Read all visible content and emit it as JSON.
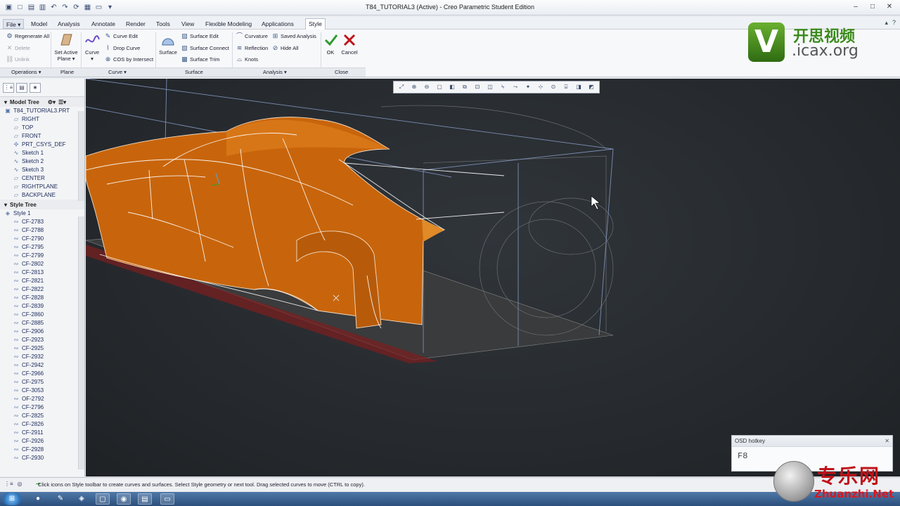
{
  "window": {
    "title": "T84_TUTORIAL3 (Active) - Creo Parametric Student Edition"
  },
  "menu": {
    "file": "File",
    "tabs": [
      "Model",
      "Analysis",
      "Annotate",
      "Render",
      "Tools",
      "View",
      "Flexible Modeling",
      "Applications",
      "Style"
    ],
    "active_tab": "Style"
  },
  "ribbon": {
    "operations": {
      "regenerate": "Regenerate All",
      "delete": "Delete",
      "unlink": "Unlink",
      "label": "Operations"
    },
    "plane": {
      "set_active": "Set Active Plane",
      "label": "Plane"
    },
    "curve": {
      "curve": "Curve",
      "curve_edit": "Curve Edit",
      "drop_curve": "Drop Curve",
      "cos": "COS by Intersect",
      "label": "Curve"
    },
    "surface": {
      "surface": "Surface",
      "surface_edit": "Surface Edit",
      "surface_connect": "Surface Connect",
      "surface_trim": "Surface Trim",
      "label": "Surface"
    },
    "analysis": {
      "curvature": "Curvature",
      "reflection": "Reflection",
      "knots": "Knots",
      "saved": "Saved Analysis",
      "hide_all": "Hide All",
      "label": "Analysis"
    },
    "close": {
      "ok": "OK",
      "cancel": "Cancel",
      "label": "Close"
    }
  },
  "logo": {
    "letter": "V",
    "cn": "开思视频",
    "url": ".icax.org"
  },
  "model_tree": {
    "header": "Model Tree",
    "items": [
      "T84_TUTORIAL3.PRT",
      "RIGHT",
      "TOP",
      "FRONT",
      "PRT_CSYS_DEF",
      "Sketch 1",
      "Sketch 2",
      "Sketch 3",
      "CENTER",
      "RIGHTPLANE",
      "BACKPLANE"
    ]
  },
  "style_tree": {
    "header": "Style Tree",
    "items": [
      "Style 1",
      "CF-2783",
      "CF-2788",
      "CF-2790",
      "CF-2795",
      "CF-2799",
      "CF-2802",
      "CF-2813",
      "CF-2821",
      "CF-2822",
      "CF-2828",
      "CF-2839",
      "CF-2860",
      "CF-2885",
      "CF-2906",
      "CF-2923",
      "CF-2925",
      "CF-2932",
      "CF-2942",
      "CF-2966",
      "CF-2975",
      "CF-3053",
      "OF-2792",
      "CF-2796",
      "CF-2825",
      "CF-2826",
      "CF-2911",
      "CF-2926",
      "CF-2928",
      "CF-2930"
    ]
  },
  "osd": {
    "header": "OSD hotkey",
    "key": "F8"
  },
  "status": {
    "message": "Click icons on Style toolbar to create curves and surfaces. Select Style geometry or next tool. Drag selected curves to move (CTRL to copy)."
  },
  "watermark": {
    "cn": "专乐网",
    "url": "Zhuanzhi.Net"
  },
  "colors": {
    "surface_orange": "#c8650c",
    "viewport_bg": "#2a2e32",
    "accent_green": "#2e9a2e",
    "cancel_red": "#c0121a"
  }
}
